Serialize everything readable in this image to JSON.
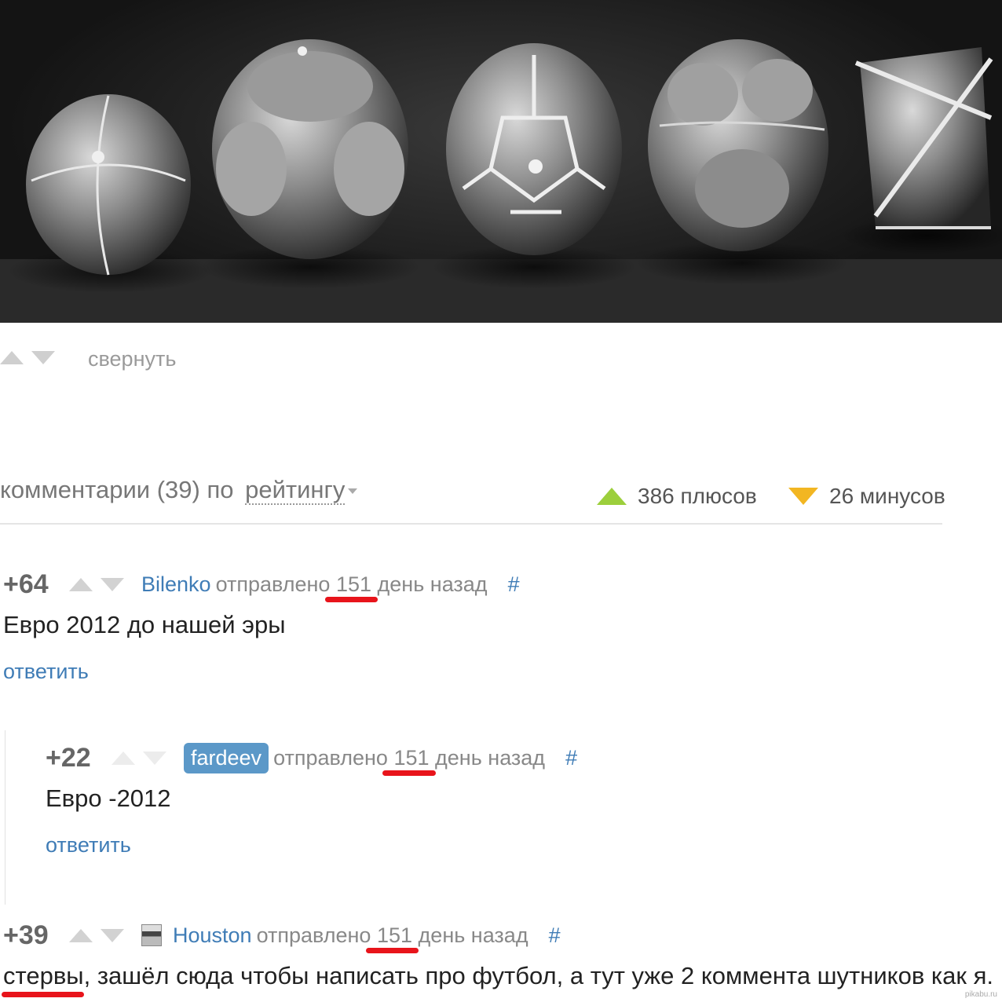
{
  "post": {
    "collapse_label": "свернуть"
  },
  "comments_header": {
    "title": "комментарии (39) по",
    "sort_label": "рейтингу",
    "pluses": "386 плюсов",
    "minuses": "26 минусов"
  },
  "comments": [
    {
      "rating": "+64",
      "author": "Bilenko",
      "sent_prefix": "отправлено",
      "days": "151",
      "sent_suffix": "день назад",
      "hash": "#",
      "text": "Евро 2012 до нашей эры",
      "reply": "ответить"
    },
    {
      "rating": "+22",
      "author": "fardeev",
      "sent_prefix": "отправлено",
      "days": "151",
      "sent_suffix": "день назад",
      "hash": "#",
      "text": "Евро -2012",
      "reply": "ответить"
    },
    {
      "rating": "+39",
      "author": "Houston",
      "sent_prefix": "отправлено",
      "days": "151",
      "sent_suffix": "день назад",
      "hash": "#",
      "text_highlight": "стервы",
      "text_rest": ", зашёл сюда чтобы написать про футбол, а тут уже 2 коммента шутников как я."
    }
  ],
  "watermark": "pikabu.ru",
  "colors": {
    "link": "#3f7cb6",
    "plus": "#9ccf3c",
    "minus": "#f2b622",
    "highlight": "#e8141b"
  }
}
